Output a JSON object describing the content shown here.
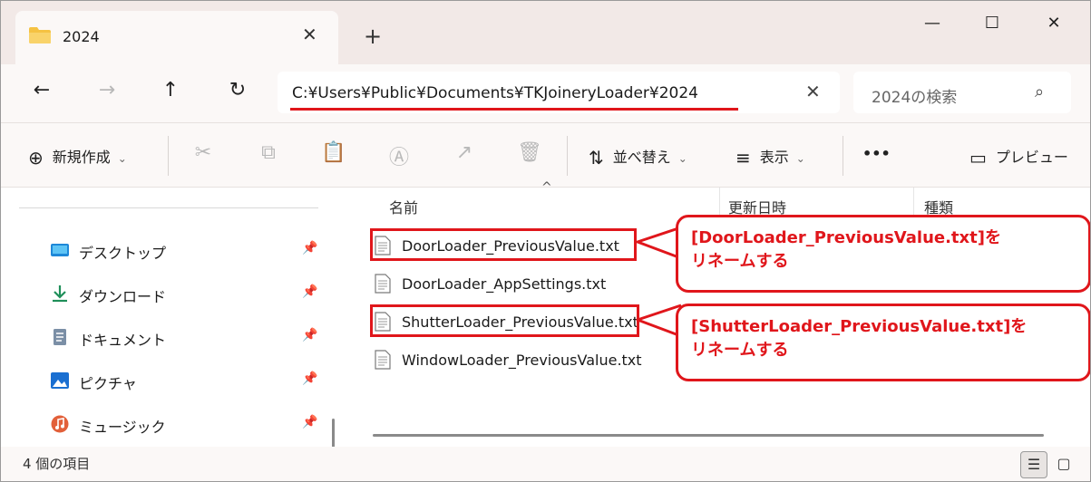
{
  "window": {
    "tab_title": "2024",
    "close_tab_glyph": "✕",
    "new_tab_glyph": "+",
    "minimize_glyph": "—",
    "maximize_glyph": "☐",
    "close_glyph": "✕"
  },
  "nav": {
    "back_glyph": "←",
    "forward_glyph": "→",
    "up_glyph": "↑",
    "refresh_glyph": "↻"
  },
  "address": {
    "path": "C:¥Users¥Public¥Documents¥TKJoineryLoader¥2024",
    "clear_glyph": "✕"
  },
  "search": {
    "placeholder": "2024の検索",
    "icon_glyph": "⌕"
  },
  "commands": {
    "new_label": "新規作成",
    "new_icon": "⊕",
    "sort_label": "並べ替え",
    "sort_icon": "⇅",
    "view_label": "表示",
    "view_icon": "≡",
    "more_label": "•••",
    "preview_label": "プレビュー",
    "preview_icon": "▭",
    "chevron": "⌄",
    "cut_icon": "✂",
    "copy_icon": "⧉",
    "paste_icon": "📋",
    "rename_icon": "Ⓐ",
    "share_icon": "↗",
    "delete_icon": "🗑"
  },
  "sidebar": {
    "items": [
      {
        "label": "デスクトップ",
        "icon": "desktop-icon"
      },
      {
        "label": "ダウンロード",
        "icon": "download-icon"
      },
      {
        "label": "ドキュメント",
        "icon": "document-icon"
      },
      {
        "label": "ピクチャ",
        "icon": "pictures-icon"
      },
      {
        "label": "ミュージック",
        "icon": "music-icon"
      }
    ],
    "pin_glyph": "📌"
  },
  "columns": {
    "name": "名前",
    "modified": "更新日時",
    "type": "種類",
    "sort_caret": "^"
  },
  "files": [
    {
      "name": "DoorLoader_PreviousValue.txt",
      "highlighted": true
    },
    {
      "name": "DoorLoader_AppSettings.txt",
      "highlighted": false
    },
    {
      "name": "ShutterLoader_PreviousValue.txt",
      "highlighted": true
    },
    {
      "name": "WindowLoader_PreviousValue.txt",
      "highlighted": false
    }
  ],
  "callouts": [
    {
      "line1": "[DoorLoader_PreviousValue.txt]を",
      "line2": "リネームする"
    },
    {
      "line1": "[ShutterLoader_PreviousValue.txt]を",
      "line2": "リネームする"
    }
  ],
  "status": {
    "item_count": "4 個の項目"
  },
  "colors": {
    "accent_red": "#e0161b",
    "titlebar": "#f2e9e7",
    "folder_yellow": "#f5c242"
  }
}
